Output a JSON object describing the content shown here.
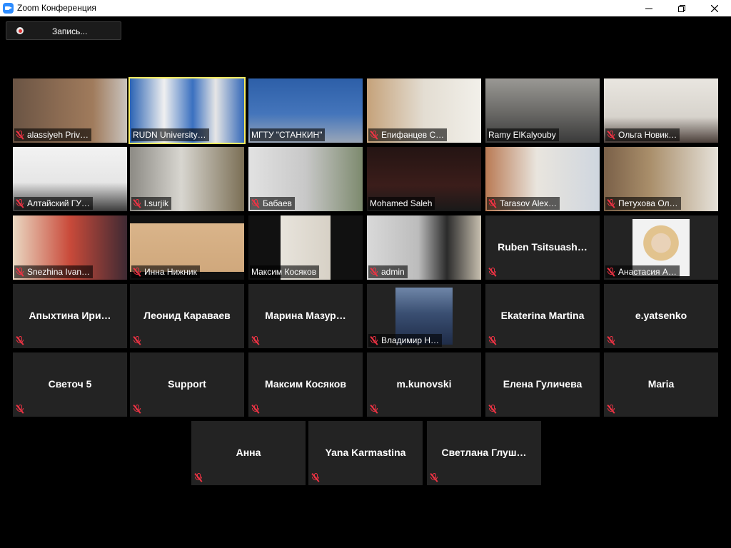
{
  "window": {
    "title": "Zoom Конференция"
  },
  "toolbar": {
    "record_label": "Запись..."
  },
  "colors": {
    "active_speaker": "#f6ec62",
    "muted_icon": "#ee3344",
    "tile_bg": "#232323"
  },
  "participants": [
    {
      "name": "alassiyeh Priv…",
      "muted": true,
      "video": true
    },
    {
      "name": "RUDN University…",
      "muted": false,
      "video": true,
      "active_speaker": true
    },
    {
      "name": "МГТУ \"СТАНКИН\"",
      "muted": false,
      "video": true
    },
    {
      "name": "Епифанцев С…",
      "muted": true,
      "video": true
    },
    {
      "name": "Ramy ElKalyouby",
      "muted": false,
      "video": true
    },
    {
      "name": "Ольга Новик…",
      "muted": true,
      "video": true
    },
    {
      "name": "Алтайский ГУ…",
      "muted": true,
      "video": true
    },
    {
      "name": "l.surjik",
      "muted": true,
      "video": true
    },
    {
      "name": "Бабаев",
      "muted": true,
      "video": true
    },
    {
      "name": "Mohamed Saleh",
      "muted": false,
      "video": true
    },
    {
      "name": "Tarasov Alex…",
      "muted": true,
      "video": true
    },
    {
      "name": "Петухова Ол…",
      "muted": true,
      "video": true
    },
    {
      "name": "Snezhina Ivan…",
      "muted": true,
      "video": true
    },
    {
      "name": "Инна Нижник",
      "muted": true,
      "video": true
    },
    {
      "name": "Максим Косяков",
      "muted": false,
      "video": true
    },
    {
      "name": "admin",
      "muted": true,
      "video": true
    },
    {
      "name": "Ruben Tsitsuash…",
      "muted": true,
      "video": false
    },
    {
      "name": "Анастасия А…",
      "muted": true,
      "video": false,
      "photo": true
    },
    {
      "name": "Апыхтина Ири…",
      "muted": true,
      "video": false
    },
    {
      "name": "Леонид Караваев",
      "muted": true,
      "video": false
    },
    {
      "name": "Марина Мазур…",
      "muted": true,
      "video": false
    },
    {
      "name": "Владимир Н…",
      "muted": true,
      "video": false,
      "photo": true
    },
    {
      "name": "Ekaterina Martina",
      "muted": true,
      "video": false
    },
    {
      "name": "e.yatsenko",
      "muted": true,
      "video": false
    },
    {
      "name": "Светоч 5",
      "muted": true,
      "video": false
    },
    {
      "name": "Support",
      "muted": true,
      "video": false
    },
    {
      "name": "Максим Косяков",
      "muted": true,
      "video": false
    },
    {
      "name": "m.kunovski",
      "muted": true,
      "video": false
    },
    {
      "name": "Елена Гуличева",
      "muted": true,
      "video": false
    },
    {
      "name": "Maria",
      "muted": true,
      "video": false
    },
    {
      "name": "Анна",
      "muted": true,
      "video": false
    },
    {
      "name": "Yana Karmastina",
      "muted": true,
      "video": false
    },
    {
      "name": "Светлана Глуш…",
      "muted": true,
      "video": false
    }
  ]
}
